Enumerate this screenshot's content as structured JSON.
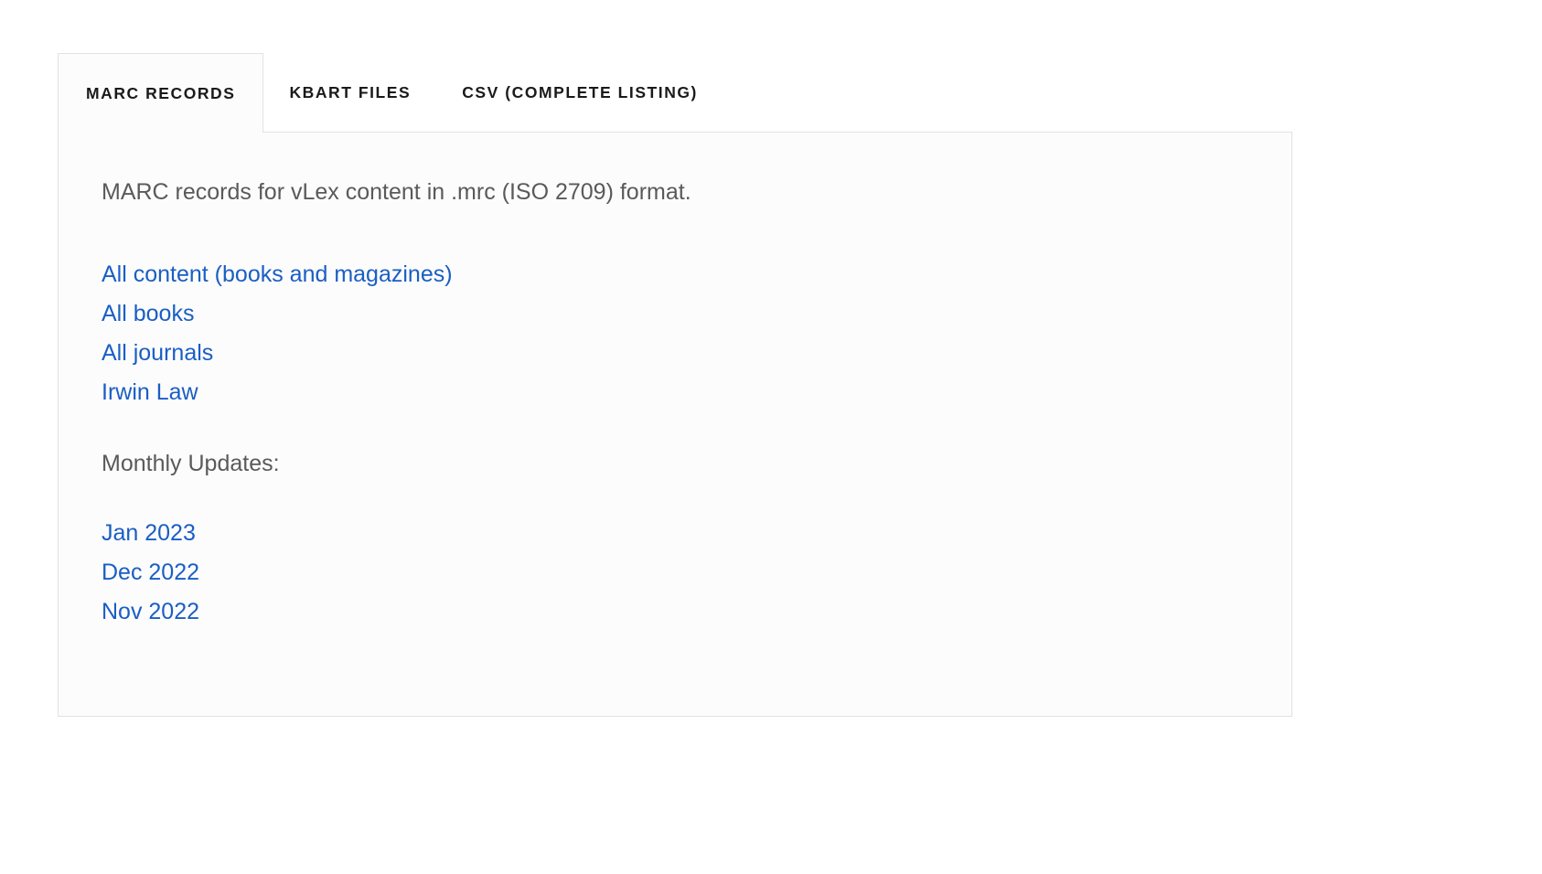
{
  "tabs": [
    {
      "label": "MARC RECORDS",
      "active": true
    },
    {
      "label": "KBART FILES",
      "active": false
    },
    {
      "label": "CSV (COMPLETE LISTING)",
      "active": false
    }
  ],
  "panel": {
    "description": "MARC records for vLex content in .mrc (ISO 2709) format.",
    "content_links": [
      {
        "label": "All content (books and magazines)"
      },
      {
        "label": "All books"
      },
      {
        "label": "All journals"
      },
      {
        "label": "Irwin Law"
      }
    ],
    "monthly_updates_label": "Monthly Updates:",
    "monthly_update_links": [
      {
        "label": "Jan 2023"
      },
      {
        "label": "Dec 2022"
      },
      {
        "label": "Nov 2022"
      }
    ]
  },
  "colors": {
    "link": "#1a5ec4",
    "text": "#5a5a5a",
    "tab_text": "#1a1a1a",
    "panel_bg": "#fcfcfc",
    "border": "#e2e2e2"
  }
}
